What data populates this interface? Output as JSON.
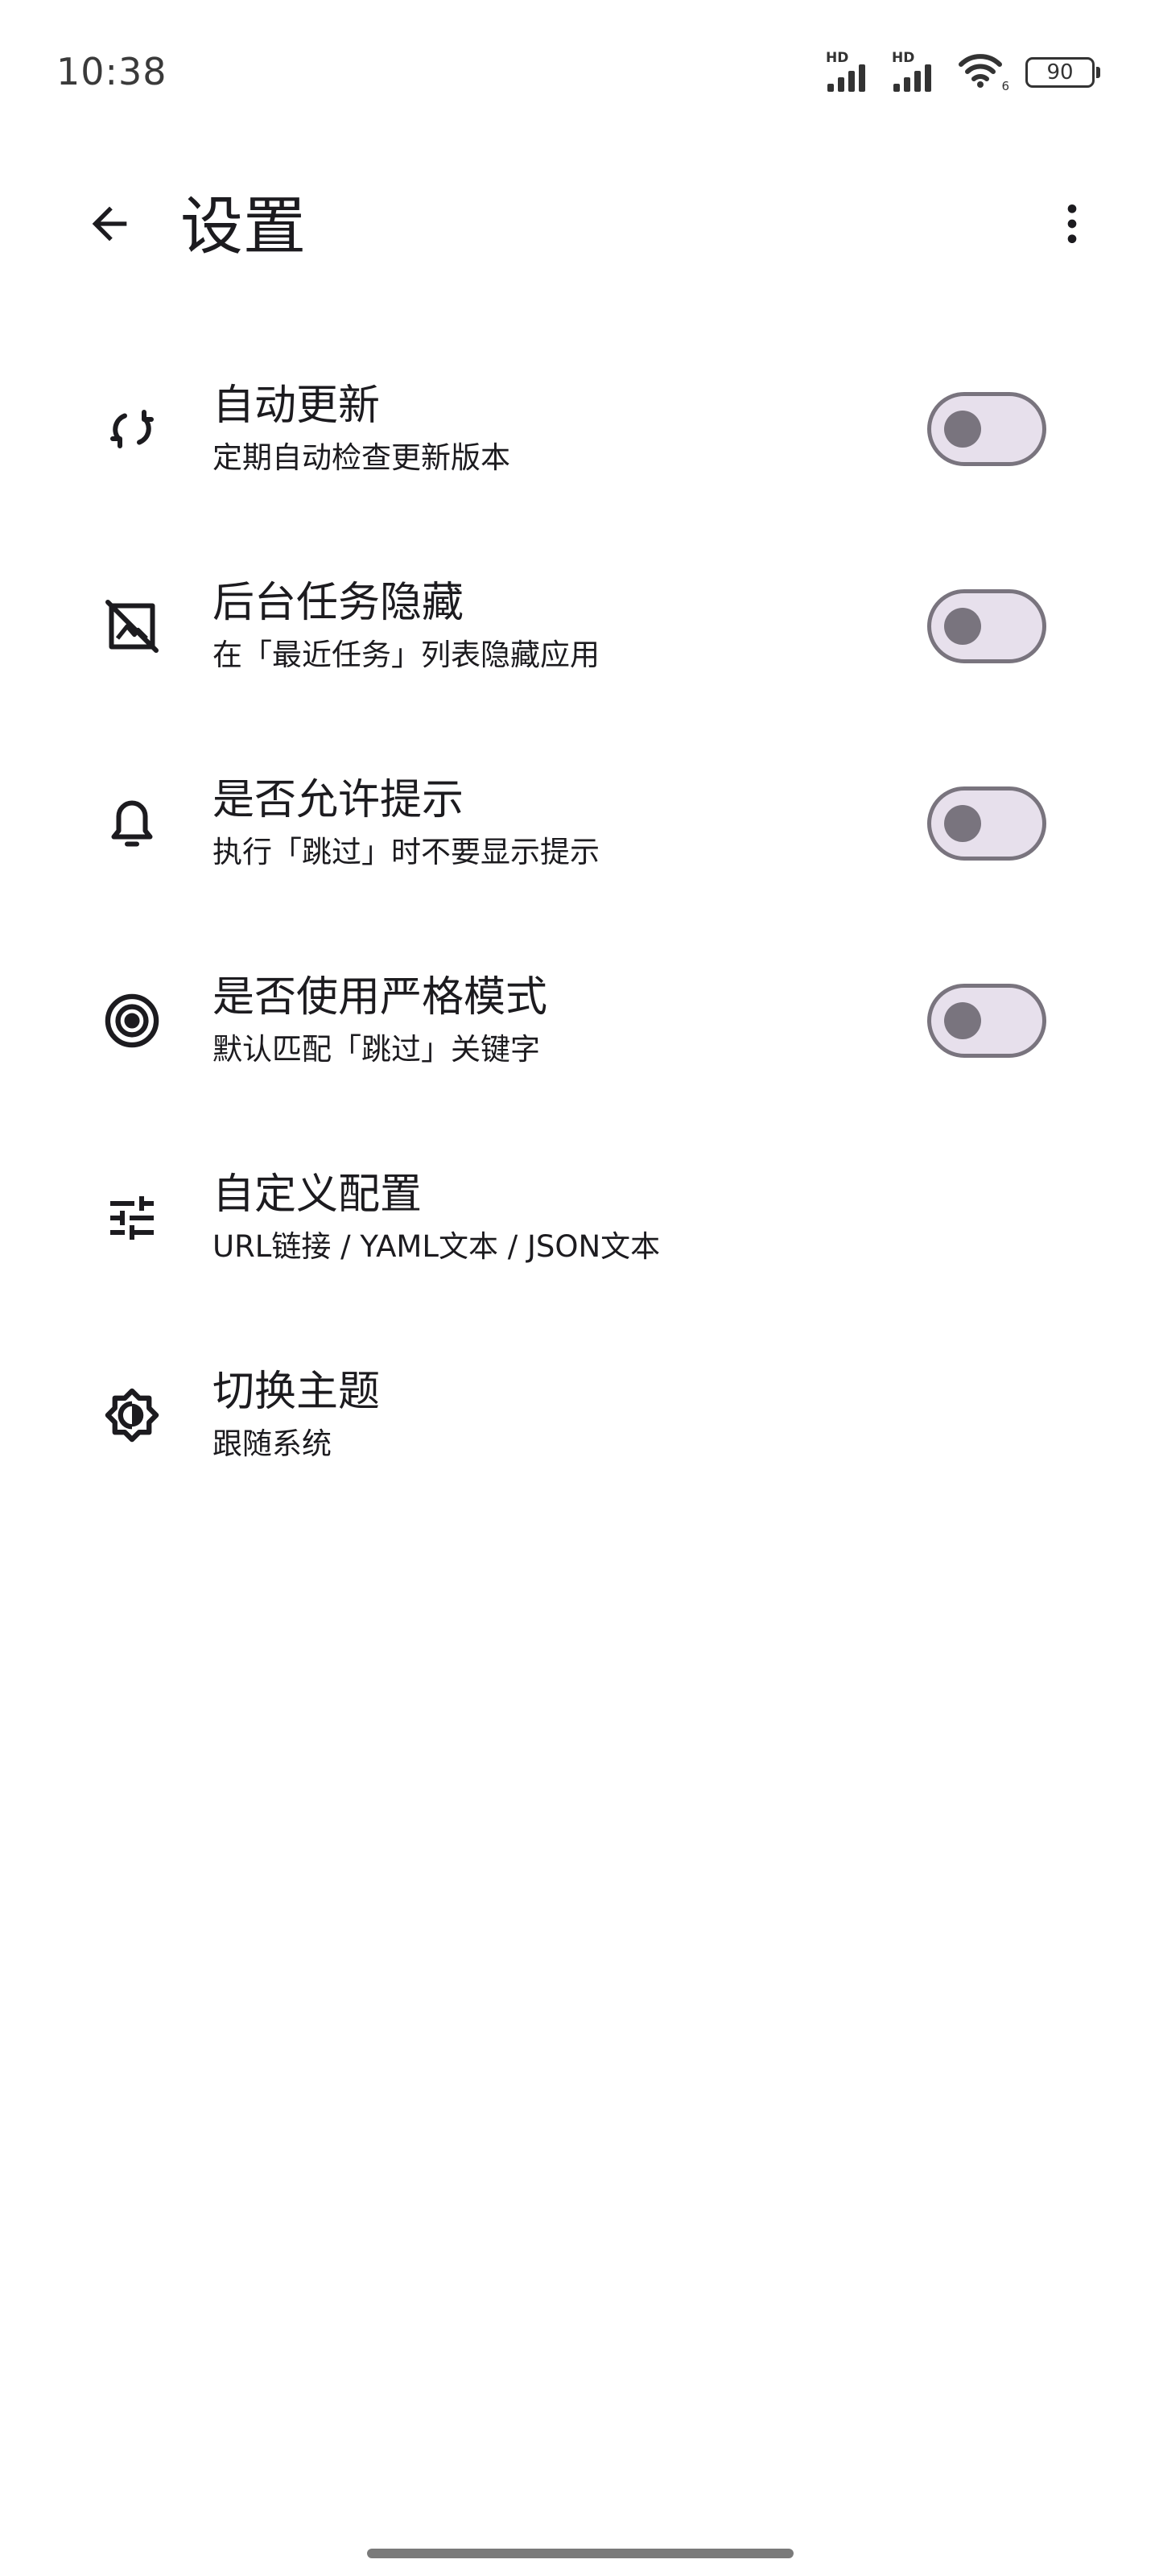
{
  "status_bar": {
    "time": "10:38",
    "signal_label": "HD",
    "wifi_label": "6",
    "battery": "90"
  },
  "app_bar": {
    "title": "设置",
    "back_icon": "arrow-back-icon",
    "more_icon": "more-vert-icon"
  },
  "settings": [
    {
      "icon": "sync-icon",
      "title": "自动更新",
      "subtitle": "定期自动检查更新版本",
      "toggle": false
    },
    {
      "icon": "hide-image-icon",
      "title": "后台任务隐藏",
      "subtitle": "在「最近任务」列表隐藏应用",
      "toggle": false
    },
    {
      "icon": "bell-icon",
      "title": "是否允许提示",
      "subtitle": "执行「跳过」时不要显示提示",
      "toggle": false
    },
    {
      "icon": "target-icon",
      "title": "是否使用严格模式",
      "subtitle": "默认匹配「跳过」关键字",
      "toggle": false
    },
    {
      "icon": "tune-icon",
      "title": "自定义配置",
      "subtitle": "URL链接 / YAML文本 / JSON文本"
    },
    {
      "icon": "brightness-icon",
      "title": "切换主题",
      "subtitle": "跟随系统"
    }
  ],
  "colors": {
    "switch_track": "#e7e0ec",
    "switch_outline": "#79747e",
    "text": "#1c1b1f"
  }
}
